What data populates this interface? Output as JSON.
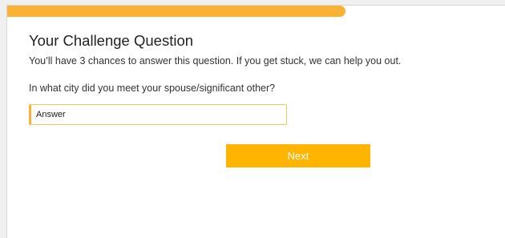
{
  "progress": {
    "fraction": 0.68,
    "color": "#f9b233"
  },
  "challenge": {
    "title": "Your Challenge Question",
    "subtitle": "You’ll have 3 chances to answer this question. If you get stuck, we can help you out.",
    "question": "In what city did you meet your spouse/significant other?",
    "answer_placeholder": "Answer",
    "answer_value": ""
  },
  "actions": {
    "next_label": "Next",
    "accent_color": "#ffb400"
  }
}
